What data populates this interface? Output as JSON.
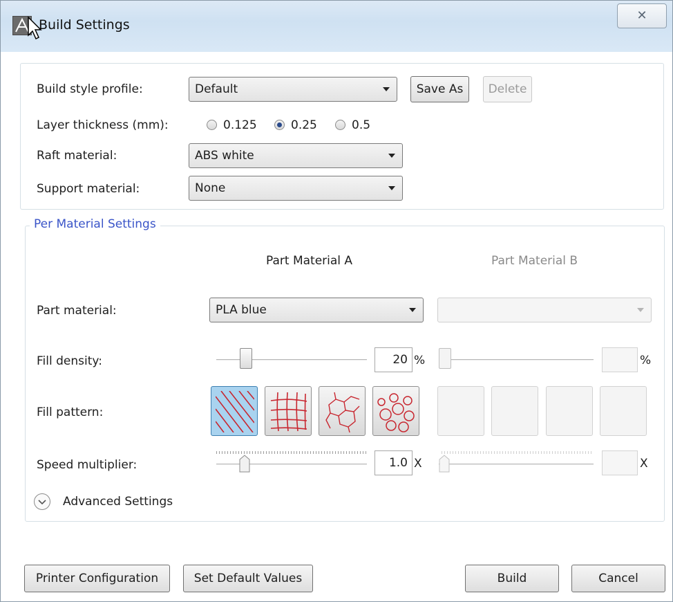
{
  "window": {
    "title": "Build Settings",
    "close_glyph": "✕"
  },
  "build_style": {
    "label": "Build style profile:",
    "value": "Default",
    "save_as": "Save As",
    "delete": "Delete"
  },
  "layer_thickness": {
    "label": "Layer thickness (mm):",
    "options": [
      "0.125",
      "0.25",
      "0.5"
    ],
    "selected": "0.25"
  },
  "raft": {
    "label": "Raft material:",
    "value": "ABS white"
  },
  "support": {
    "label": "Support material:",
    "value": "None"
  },
  "per_material": {
    "legend": "Per Material Settings",
    "col_a": "Part Material A",
    "col_b": "Part Material B",
    "part_material": {
      "label": "Part material:",
      "a_value": "PLA blue",
      "b_value": ""
    },
    "fill_density": {
      "label": "Fill density:",
      "a_value": "20",
      "a_unit": "%",
      "b_value": "",
      "b_unit": "%",
      "a_level": 0.2
    },
    "fill_pattern": {
      "label": "Fill pattern:",
      "patterns": [
        "diagonal-lines-pattern-icon",
        "grid-pattern-icon",
        "honeycomb-pattern-icon",
        "circles-pattern-icon"
      ],
      "selected_index": 0
    },
    "speed": {
      "label": "Speed multiplier:",
      "a_value": "1.0",
      "a_unit": "X",
      "b_value": "",
      "b_unit": "X"
    },
    "advanced": "Advanced Settings"
  },
  "footer": {
    "printer_config": "Printer Configuration",
    "set_defaults": "Set Default Values",
    "build": "Build",
    "cancel": "Cancel"
  },
  "colors": {
    "legend": "#3a54c8",
    "pattern_red": "#c8262f",
    "selected_fill": "#a9d3ef"
  }
}
